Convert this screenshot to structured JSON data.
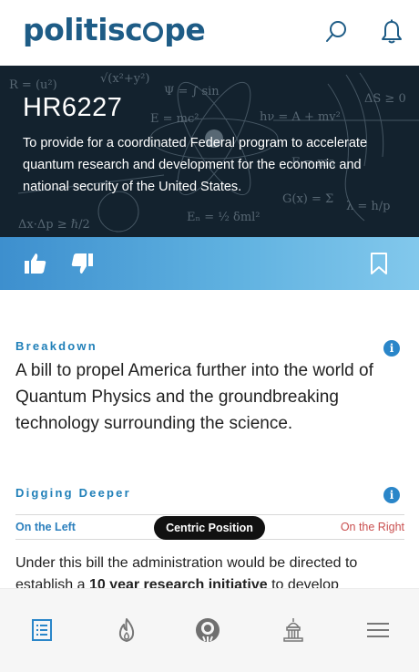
{
  "header": {
    "logo_prefix": "politisc",
    "logo_suffix": "pe",
    "search_icon": "search-icon",
    "bell_icon": "bell-icon"
  },
  "bill": {
    "id": "HR6227",
    "description": "To provide for a coordinated Federal program to accelerate quantum research and development for the economic and national security of the United States."
  },
  "actions": {
    "like_icon": "thumbs-up-icon",
    "dislike_icon": "thumbs-down-icon",
    "bookmark_icon": "bookmark-icon"
  },
  "breakdown": {
    "label": "Breakdown",
    "text": "A bill to propel America further into the world of Quantum Physics and the groundbreaking technology surrounding the science."
  },
  "digging_deeper": {
    "label": "Digging Deeper",
    "left_label": "On the Left",
    "center_label": "Centric Position",
    "right_label": "On the Right",
    "text_before": "Under this bill the administration would be directed to establish a ",
    "text_bold": "10 year research initiative",
    "text_after": " to develop"
  },
  "nav": {
    "items": [
      "bills-icon",
      "trending-flame-icon",
      "scope-icon",
      "capitol-icon",
      "menu-icon"
    ]
  },
  "colors": {
    "brand": "#1e5c86",
    "accent": "#2a86c9",
    "left": "#2b7fbd",
    "right": "#c94f4f"
  }
}
